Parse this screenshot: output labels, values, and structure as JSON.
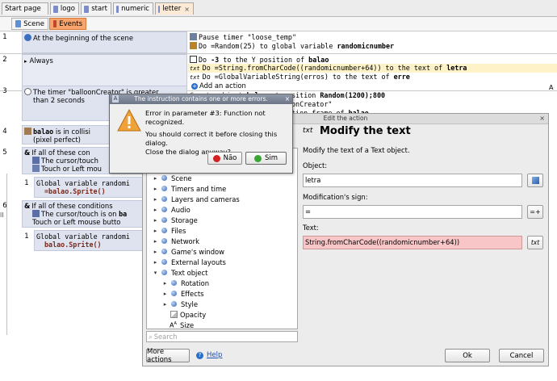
{
  "tabs": [
    {
      "label": "Start page",
      "icon": "none",
      "active": false
    },
    {
      "label": "logo",
      "icon": "scene-icon",
      "active": false
    },
    {
      "label": "start",
      "icon": "scene-icon",
      "active": false
    },
    {
      "label": "numeric",
      "icon": "scene-icon",
      "active": false
    },
    {
      "label": "letter",
      "icon": "scene-icon",
      "active": true
    }
  ],
  "subtabs": {
    "scene": "Scene",
    "events": "Events"
  },
  "events": {
    "e1": {
      "num": "1",
      "cond": "At the beginning of the scene",
      "act1": "Pause timer \"loose_temp\"",
      "act2_pre": "Do =Random(25) to global variable ",
      "act2_var": "randomicnumber"
    },
    "e2": {
      "num": "2",
      "cond": "Always",
      "act1_pre": "Do ",
      "act1_val": "-3",
      "act1_mid": " to the Y position of ",
      "act1_obj": "balao",
      "act2_pre": "Do =String.fromCharCode((randomicnumber+64)) to the text of ",
      "act2_obj": "letra",
      "act3_pre": "Do =GlobalVariableString(erros) to the text of ",
      "act3_obj": "erre",
      "add_action": "Add an action"
    },
    "e3": {
      "num": "3",
      "cond1": "The timer \"balloonCreator\" is greater",
      "cond2": "than 2 seconds",
      "act1_pre": "at position ",
      "act1_val": "Random(1200);800",
      "act2": "onCreator\"",
      "act3_pre": "tion frame of ",
      "act3_obj": "balao"
    },
    "e4": {
      "num": "4",
      "cond1_obj": "balao",
      "cond1": " is in collisi",
      "cond2": "(pixel perfect)"
    },
    "e5": {
      "num": "5",
      "header": "If all of these con",
      "c1": "The cursor/touch",
      "c2": "Touch or Left mou"
    },
    "e5_1": {
      "num": "1",
      "l1": "Global variable randomi",
      "l2": "=balao.Sprite()"
    },
    "e6": {
      "num": "6",
      "header": "If all of these conditions",
      "c1_pre": "The cursor/touch is on ",
      "c1_obj": "ba",
      "c2": "Touch or Left mouse butto"
    },
    "e6_1": {
      "num": "1",
      "l1": "Global variable randomi",
      "l2": "balao.Sprite()"
    }
  },
  "left_edge_text": "ll",
  "error_dialog": {
    "title": "The instruction contains one or more errors.",
    "line1": "Error in parameter #3: Function not recognized.",
    "line2": "You should correct it before closing this dialog.",
    "line3": "Close the dialog anyway?",
    "no_label": "Não",
    "yes_label": "Sim"
  },
  "edit_dialog": {
    "title": "Edit the action",
    "action_icon": "txt",
    "heading": "Modify the text",
    "description": "Modify the text of a Text object.",
    "object_label": "Object:",
    "object_value": "letra",
    "sign_label": "Modification's sign:",
    "sign_value": "=",
    "text_label": "Text:",
    "text_value": "String.fromCharCode((randomicnumber+64))",
    "text_btn": "txt",
    "search_placeholder": "Search",
    "more_actions": "More actions",
    "help": "Help",
    "ok": "Ok",
    "cancel": "Cancel",
    "tree": [
      {
        "label": "Scene",
        "level": 0,
        "expander": "▸",
        "icon": "dot"
      },
      {
        "label": "Timers and time",
        "level": 0,
        "expander": "▸",
        "icon": "dot"
      },
      {
        "label": "Layers and cameras",
        "level": 0,
        "expander": "▸",
        "icon": "dot"
      },
      {
        "label": "Audio",
        "level": 0,
        "expander": "▸",
        "icon": "dot"
      },
      {
        "label": "Storage",
        "level": 0,
        "expander": "▸",
        "icon": "dot"
      },
      {
        "label": "Files",
        "level": 0,
        "expander": "▸",
        "icon": "dot"
      },
      {
        "label": "Network",
        "level": 0,
        "expander": "▸",
        "icon": "dot"
      },
      {
        "label": "Game's window",
        "level": 0,
        "expander": "▸",
        "icon": "dot"
      },
      {
        "label": "External layouts",
        "level": 0,
        "expander": "▸",
        "icon": "dot"
      },
      {
        "label": "Text object",
        "level": 0,
        "expander": "▾",
        "icon": "dot"
      },
      {
        "label": "Rotation",
        "level": 1,
        "expander": "▸",
        "icon": "dot"
      },
      {
        "label": "Effects",
        "level": 1,
        "expander": "▸",
        "icon": "dot"
      },
      {
        "label": "Style",
        "level": 1,
        "expander": "▸",
        "icon": "dot"
      },
      {
        "label": "Opacity",
        "level": 1,
        "expander": "",
        "icon": "opacity"
      },
      {
        "label": "Size",
        "level": 1,
        "expander": "",
        "icon": "size"
      }
    ]
  },
  "colors": {
    "selected_tab": "#fce9d6",
    "events_tab": "#f7a56c",
    "condition_bg": "#dfe3ef",
    "highlight_row": "#fdf2c8",
    "error_field": "#f8c6c6",
    "variable": "#7a2a1a",
    "help_link": "#1a4fb8"
  }
}
